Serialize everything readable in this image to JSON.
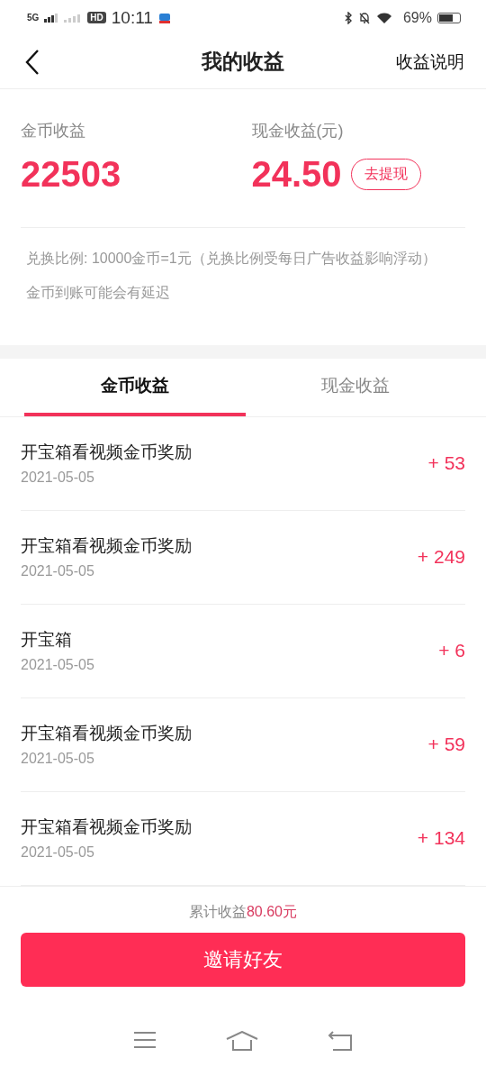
{
  "status_bar": {
    "network": "5G",
    "hd": "HD",
    "time": "10:11",
    "battery": "69%"
  },
  "header": {
    "title": "我的收益",
    "action": "收益说明"
  },
  "summary": [
    {
      "label": "金币收益",
      "value": "22503"
    },
    {
      "label": "现金收益(元)",
      "value": "24.50",
      "button": "去提现"
    }
  ],
  "notes": [
    "兑换比例: 10000金币=1元（兑换比例受每日广告收益影响浮动）",
    "金币到账可能会有延迟"
  ],
  "tabs": [
    {
      "label": "金币收益",
      "selected": true
    },
    {
      "label": "现金收益",
      "selected": false
    }
  ],
  "records": [
    {
      "title": "开宝箱看视频金币奖励",
      "date": "2021-05-05",
      "amount": "+ 53"
    },
    {
      "title": "开宝箱看视频金币奖励",
      "date": "2021-05-05",
      "amount": "+ 249"
    },
    {
      "title": "开宝箱",
      "date": "2021-05-05",
      "amount": "+ 6"
    },
    {
      "title": "开宝箱看视频金币奖励",
      "date": "2021-05-05",
      "amount": "+ 59"
    },
    {
      "title": "开宝箱看视频金币奖励",
      "date": "2021-05-05",
      "amount": "+ 134"
    }
  ],
  "footer": {
    "total_label": "累计收益",
    "total_value": "80.60元",
    "button": "邀请好友"
  }
}
